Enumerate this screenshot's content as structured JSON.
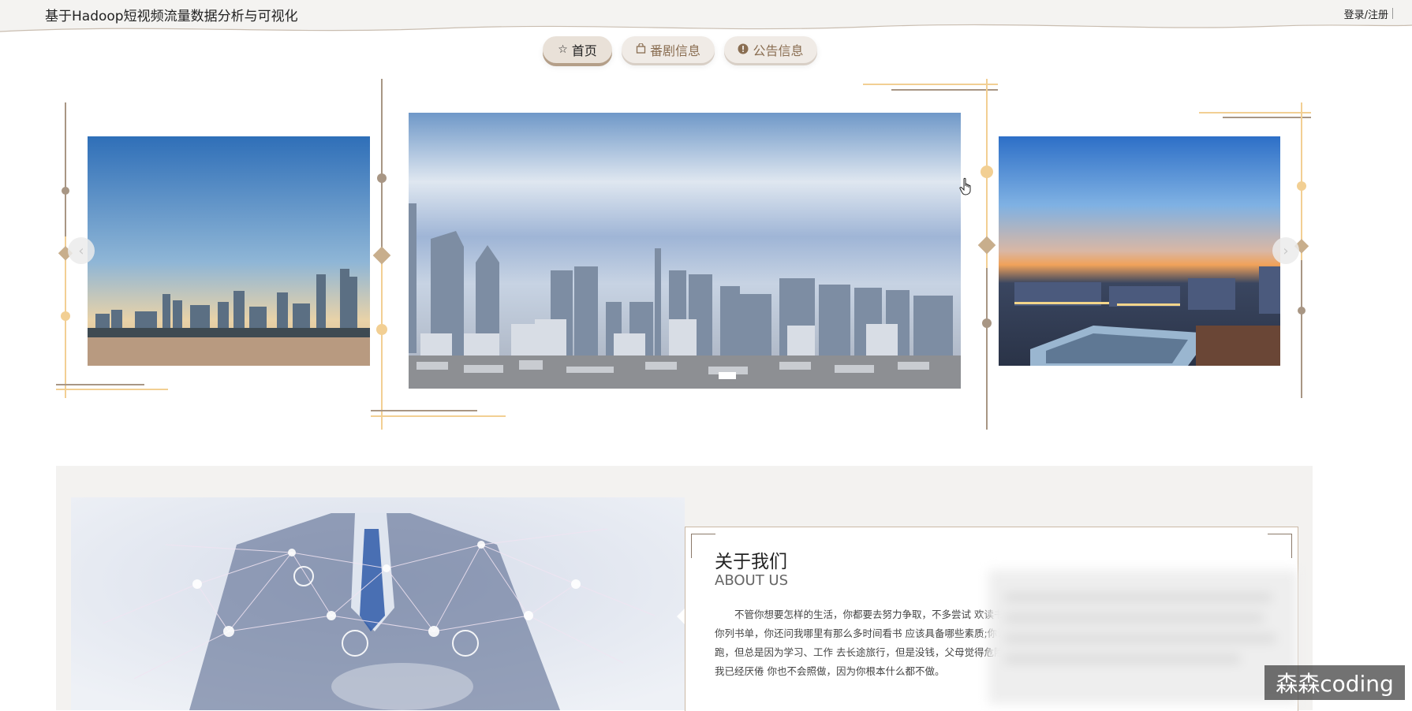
{
  "header": {
    "title": "基于Hadoop短视频流量数据分析与可视化",
    "login_label": "登录/注册"
  },
  "nav": {
    "items": [
      {
        "label": "首页",
        "icon": "star-icon",
        "active": true
      },
      {
        "label": "番剧信息",
        "icon": "bag-icon",
        "active": false
      },
      {
        "label": "公告信息",
        "icon": "info-circle-icon",
        "active": false
      }
    ]
  },
  "carousel": {
    "prev_icon": "chevron-left-icon",
    "next_icon": "chevron-right-icon",
    "slides": [
      {
        "name": "city-skyline-dusk",
        "position": "left"
      },
      {
        "name": "city-skyline-day",
        "position": "center"
      },
      {
        "name": "city-stadium-night",
        "position": "right"
      }
    ]
  },
  "about": {
    "title_cn": "关于我们",
    "title_en": "ABOUT US",
    "text": "不管你想要怎样的生活，你都要去努力争取，不多尝试 欢读书，让我给你列书单，你还问我哪里有那么多时间看书 应该具备哪些素质;你说你计划晨跑，但总是因为学习、工作 去长途旅行，但是没钱，父母觉得危险。其实，我已经厌倦 你也不会照做，因为你根本什么都不做。"
  },
  "watermark": "森森coding",
  "colors": {
    "accent_gold": "#b49f89",
    "deco_gold": "#f2cf93",
    "deco_brown": "#a89684",
    "section_bg": "#f3f2f0"
  }
}
